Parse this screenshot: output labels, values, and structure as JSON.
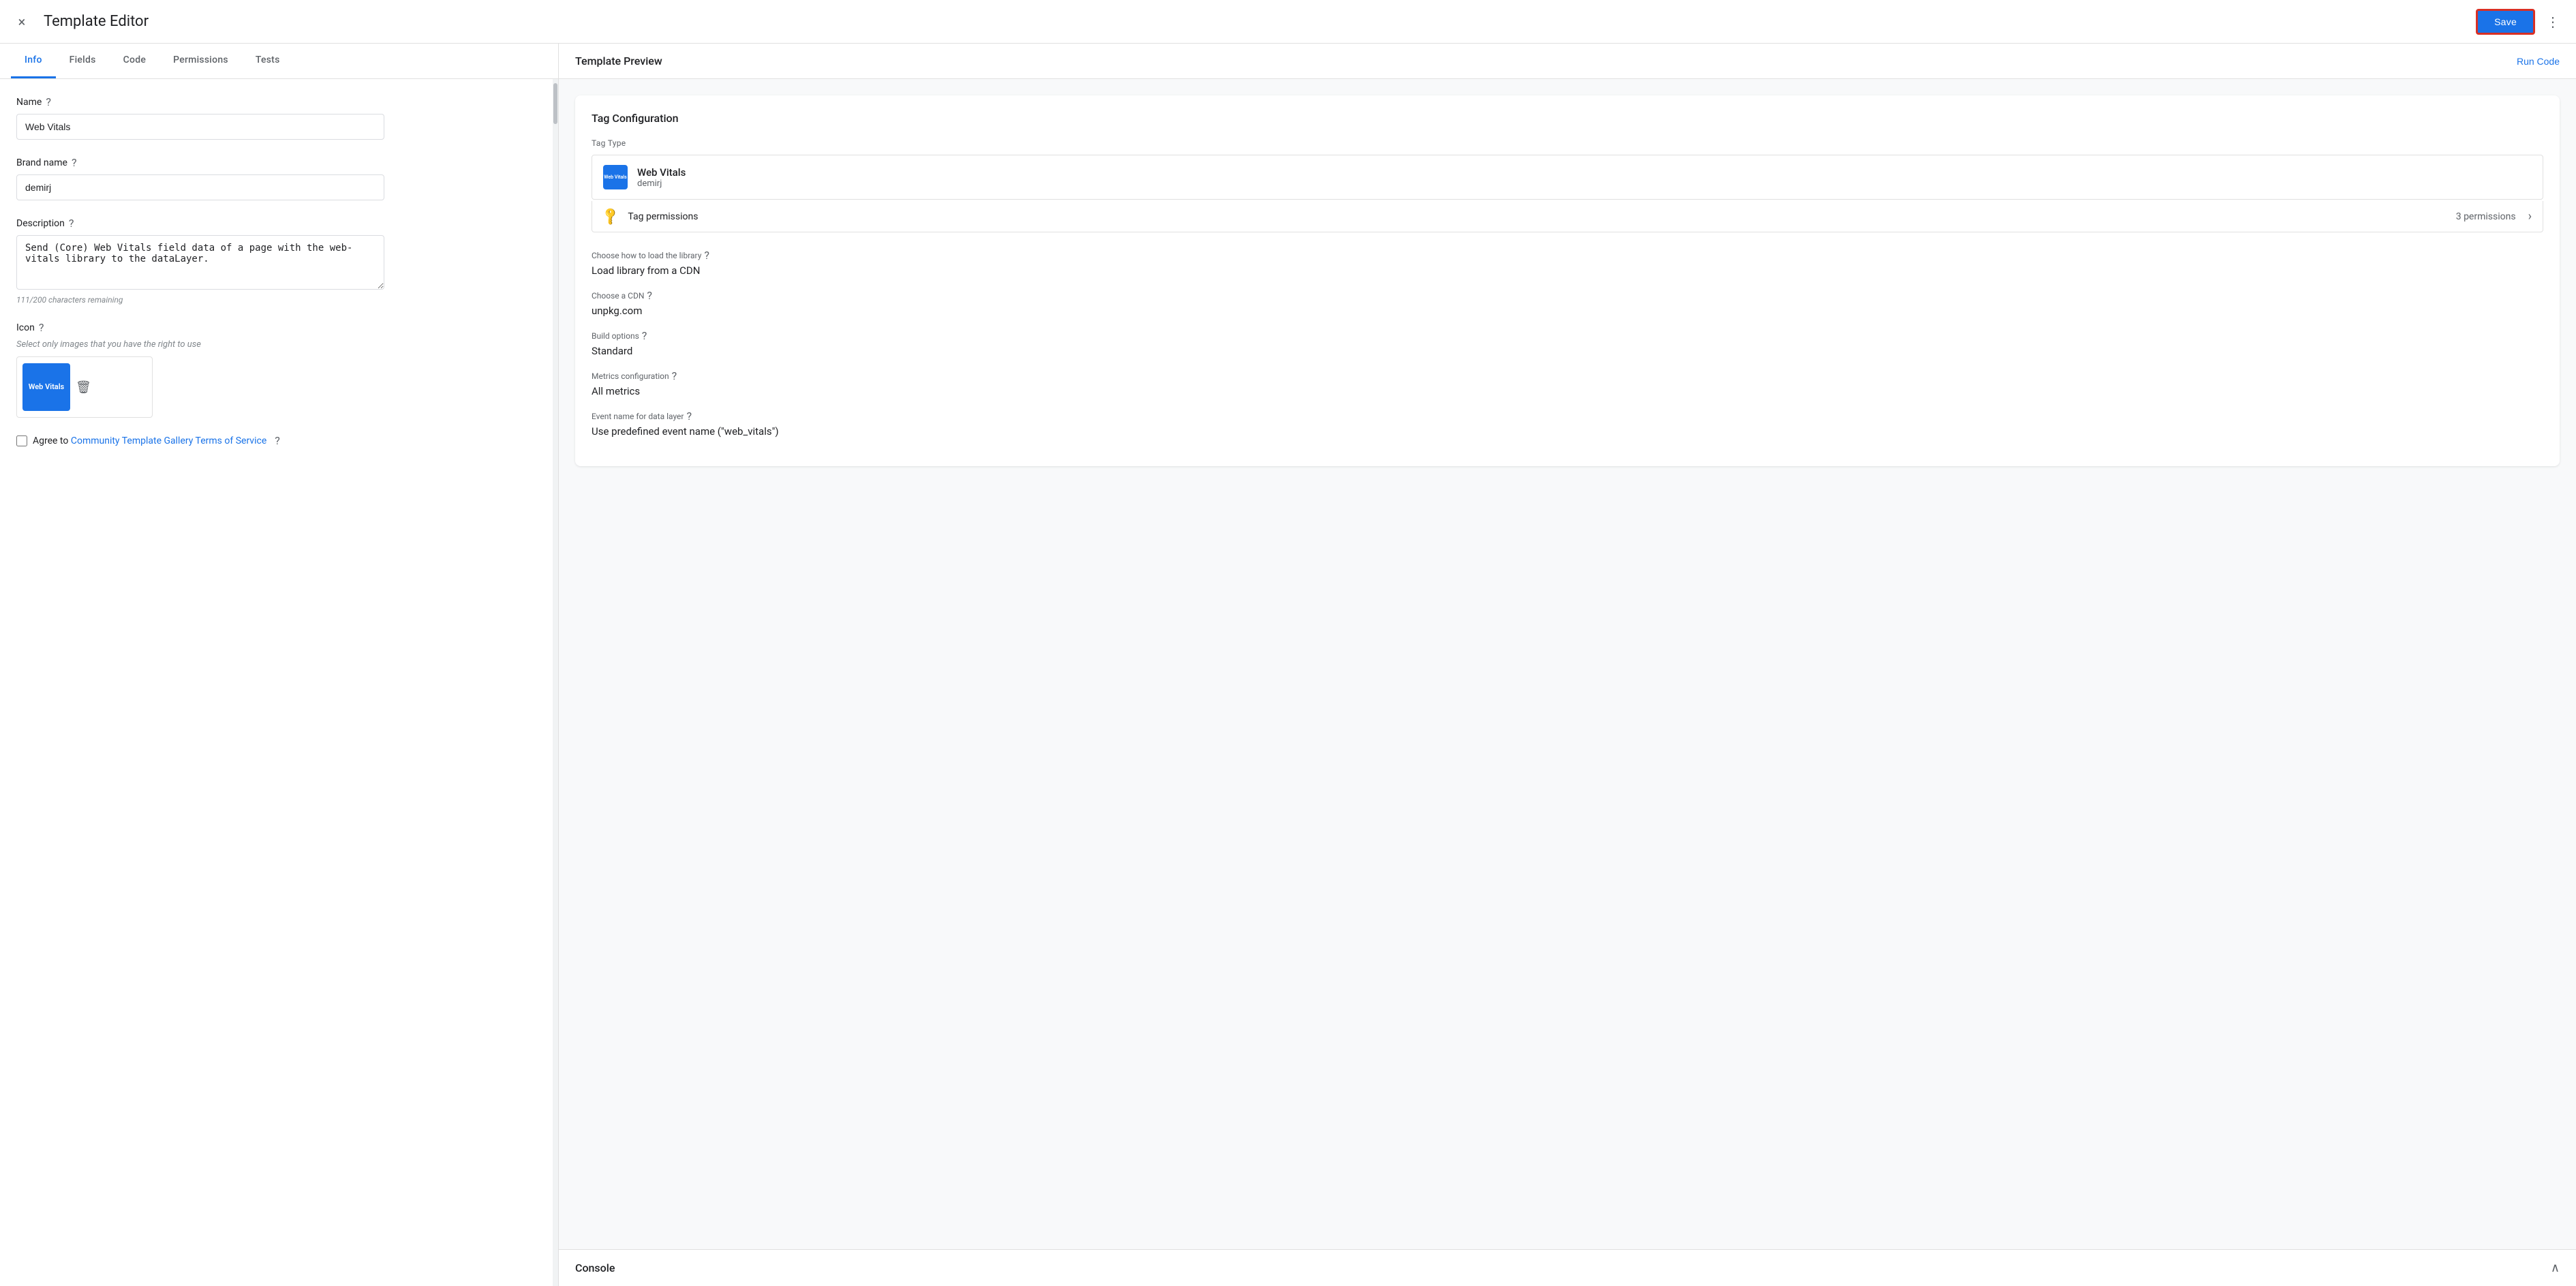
{
  "header": {
    "title": "Template Editor",
    "save_label": "Save",
    "close_icon": "×",
    "more_icon": "⋮"
  },
  "tabs": [
    {
      "id": "info",
      "label": "Info",
      "active": true
    },
    {
      "id": "fields",
      "label": "Fields",
      "active": false
    },
    {
      "id": "code",
      "label": "Code",
      "active": false
    },
    {
      "id": "permissions",
      "label": "Permissions",
      "active": false
    },
    {
      "id": "tests",
      "label": "Tests",
      "active": false
    }
  ],
  "form": {
    "name_label": "Name",
    "name_value": "Web Vitals",
    "brand_label": "Brand name",
    "brand_value": "demirj",
    "description_label": "Description",
    "description_value": "Send (Core) Web Vitals field data of a page with the web-vitals library to the dataLayer.",
    "char_count": "111/200 characters remaining",
    "icon_label": "Icon",
    "icon_helper": "Select only images that you have the right to use",
    "icon_text": "Web Vitals",
    "agree_text": "Agree to ",
    "agree_link": "Community Template Gallery Terms of Service"
  },
  "preview": {
    "title": "Template Preview",
    "run_code_label": "Run Code",
    "tag_config_title": "Tag Configuration",
    "tag_type_label": "Tag Type",
    "wv_name": "Web Vitals",
    "wv_brand": "demirj",
    "permissions_label": "Tag permissions",
    "permissions_count": "3 permissions",
    "cdn_label": "Choose how to load the library",
    "cdn_value": "Load library from a CDN",
    "cdn_select_label": "Choose a CDN",
    "cdn_select_value": "unpkg.com",
    "build_label": "Build options",
    "build_value": "Standard",
    "metrics_label": "Metrics configuration",
    "metrics_value": "All metrics",
    "event_label": "Event name for data layer",
    "event_value": "Use predefined event name (\"web_vitals\")",
    "console_title": "Console"
  }
}
